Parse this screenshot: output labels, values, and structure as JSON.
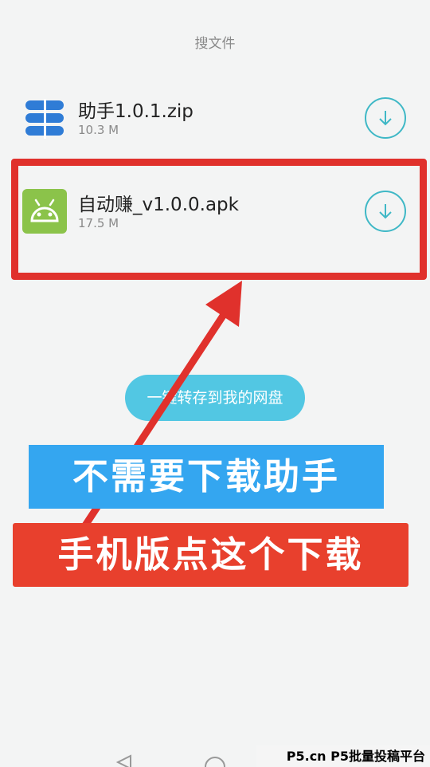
{
  "page_title": "搜文件",
  "files": [
    {
      "name": "助手1.0.1.zip",
      "size": "10.3 M",
      "icon": "zip-file-icon"
    },
    {
      "name": "自动赚_v1.0.0.apk",
      "size": "17.5 M",
      "icon": "android-apk-icon"
    }
  ],
  "save_button_label": "一键转存到我的网盘",
  "overlay": {
    "banner_blue_text": "不需要下载助手",
    "banner_red_text": "手机版点这个下载",
    "highlight_color": "#e0312c"
  },
  "watermark": "P5.cn P5批量投稿平台",
  "colors": {
    "accent": "#3fb8c6",
    "button": "#52c7e3",
    "banner_blue": "#34a6f0",
    "banner_red": "#e8402d"
  }
}
